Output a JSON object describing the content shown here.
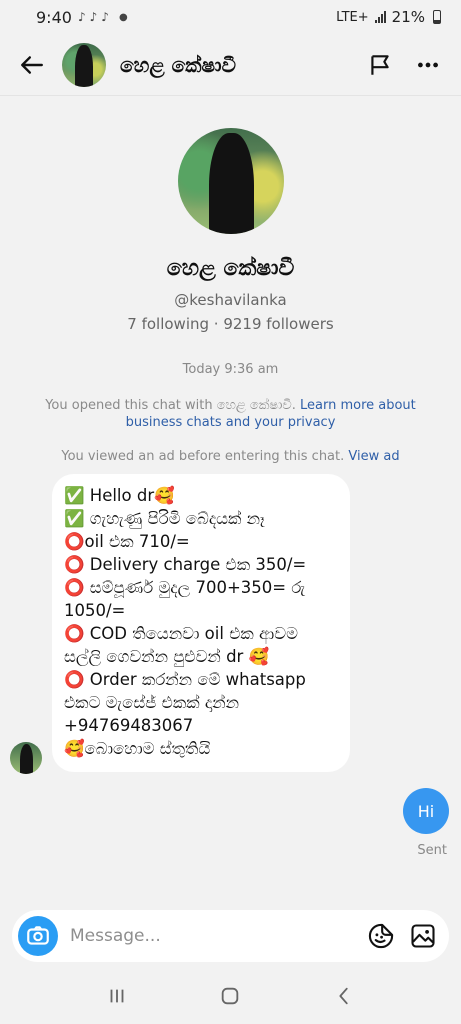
{
  "status_bar": {
    "time": "9:40",
    "battery": "21%",
    "network": "LTE+"
  },
  "header": {
    "title": "හෙළ කේෂාවී"
  },
  "profile": {
    "name": "හෙළ කේෂාවී",
    "handle": "@keshavilanka",
    "stats": "7 following · 9219 followers"
  },
  "chat": {
    "timestamp": "Today 9:36 am",
    "notice_opened_text": "You opened this chat with හෙළ කේෂාවී.",
    "notice_opened_link": "Learn more about business chats and your privacy",
    "notice_ad_text": "You viewed an ad before entering this chat.",
    "notice_ad_link": "View ad",
    "incoming_lines": [
      "✅ Hello dr🥰",
      "✅ ගැහැණු පිරිමි බේදයක් නෑ",
      "⭕oil එක 710/=",
      "⭕ Delivery charge එක 350/=",
      "⭕ සම්පූර්ණ මුදල 700+350= රු 1050/=",
      "⭕ COD තියෙනවා oil එක ආවම සල්ලි ගෙවන්න පුළුවන් dr 🥰",
      "⭕ Order කරන්න මේ whatsapp එකට මැසේජ් එකක් දාන්න +94769483067",
      "🥰බොහොම ස්තුතියි"
    ],
    "outgoing_message": "Hi",
    "outgoing_status": "Sent"
  },
  "composer": {
    "placeholder": "Message..."
  },
  "icons": {
    "back": "arrow-left-icon",
    "flag": "flag-icon",
    "more": "more-horizontal-icon",
    "camera": "camera-icon",
    "sticker": "sticker-icon",
    "gallery": "gallery-icon"
  },
  "colors": {
    "accent_blue": "#3797f0",
    "link_blue": "#2f5fa8",
    "background": "#f2f2f2"
  }
}
